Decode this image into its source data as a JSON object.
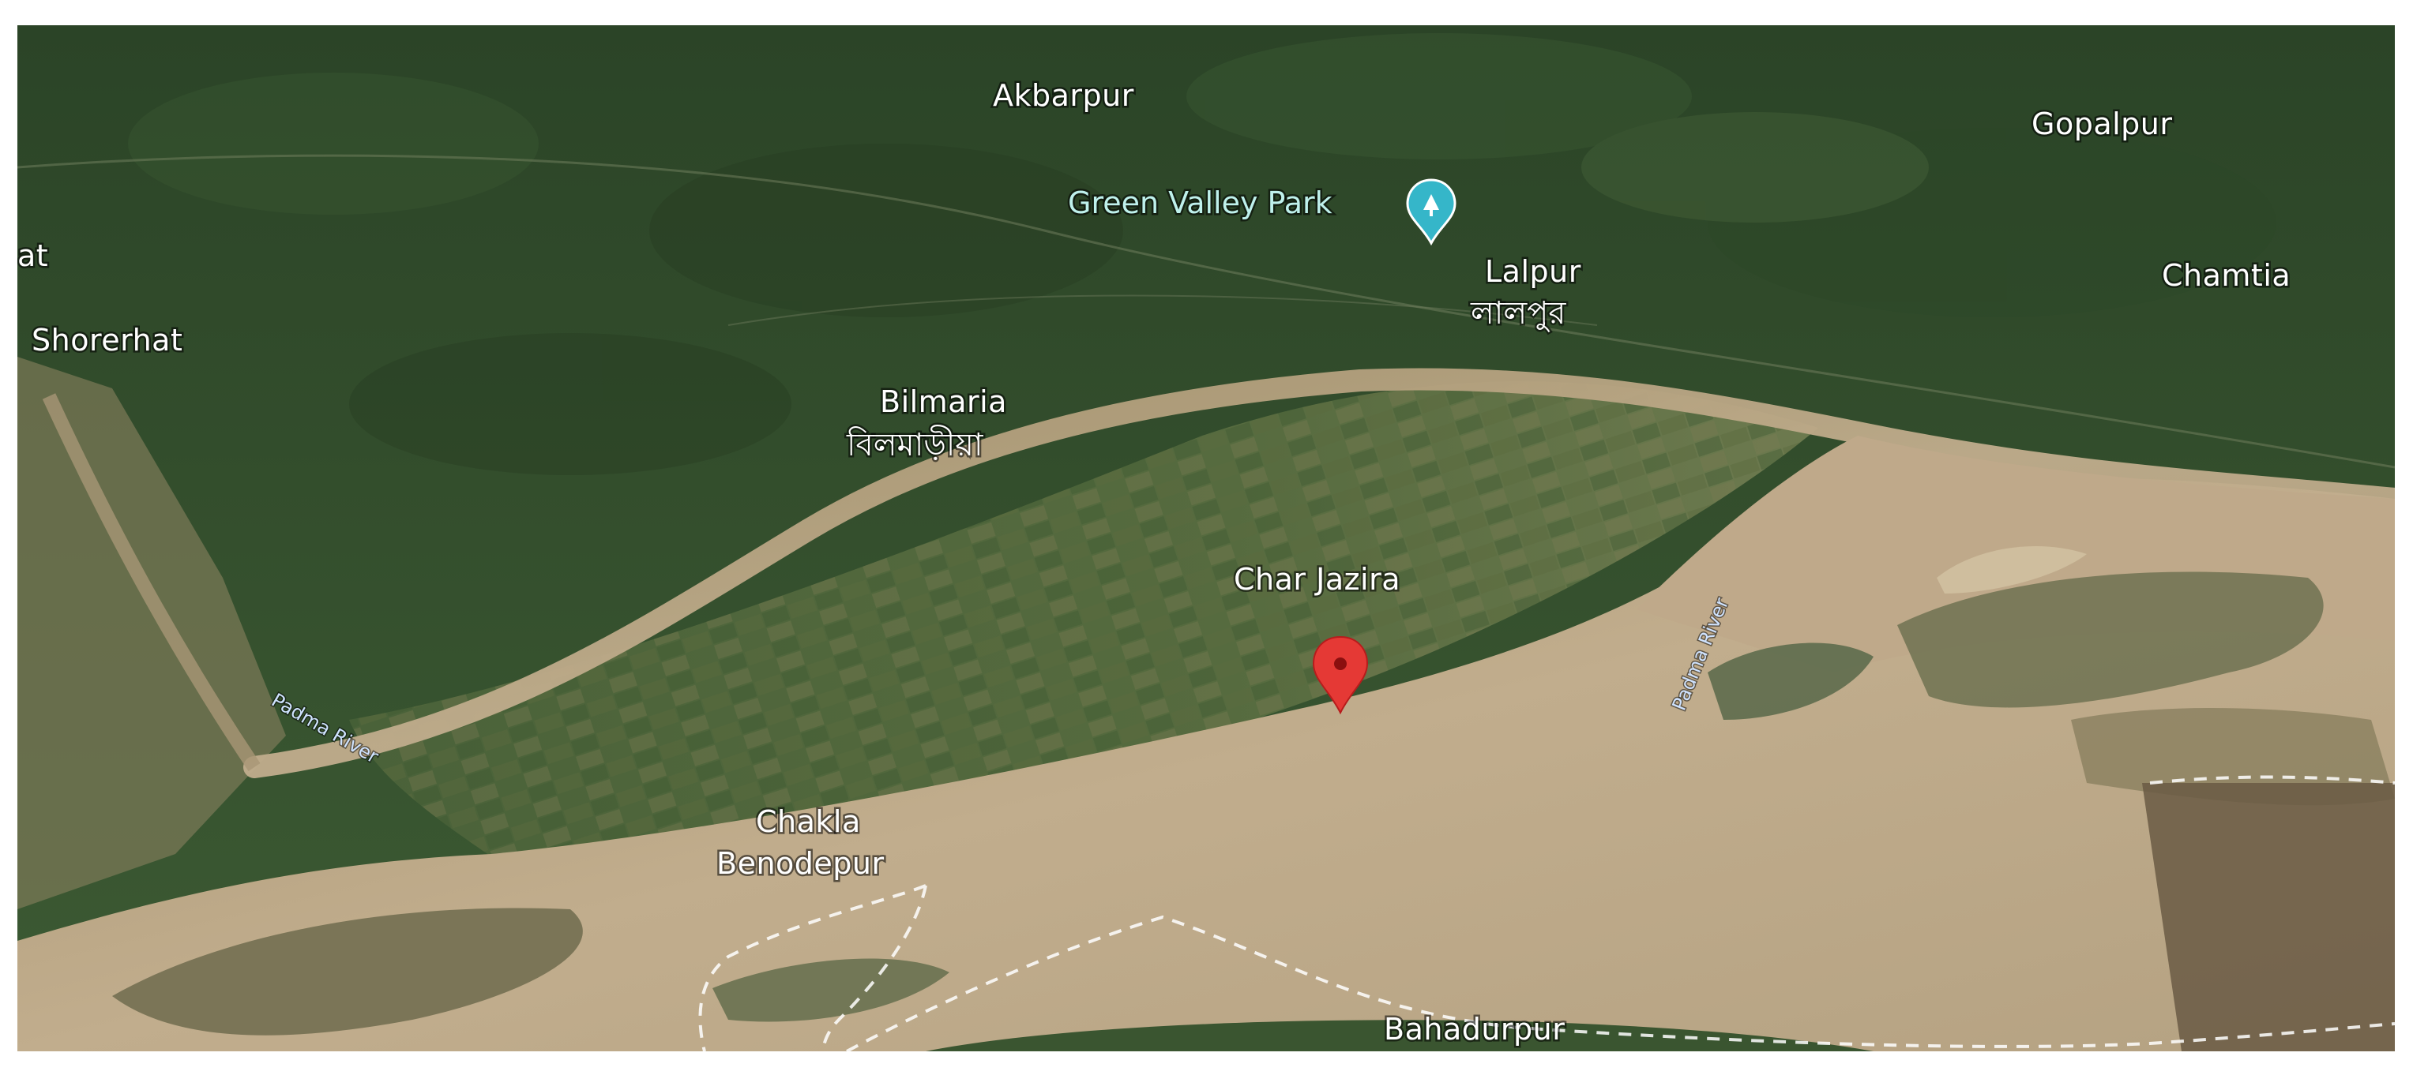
{
  "map": {
    "view": "satellite",
    "colors": {
      "vegetation": "#2f4a2b",
      "river": "#bca88a",
      "marker": "#e53935",
      "poi": "#35b6c9",
      "boundary": "#ffffff"
    },
    "places": {
      "akbarpur": "Akbarpur",
      "gopalpur": "Gopalpur",
      "green_valley_park": "Green Valley Park",
      "lalpur_en": "Lalpur",
      "lalpur_bn": "লালপুর",
      "chamtia": "Chamtia",
      "edge_cut": "at",
      "shorerhat": "Shorerhat",
      "bilmaria_en": "Bilmaria",
      "bilmaria_bn": "বিলমাড়ীয়া",
      "char_jazira": "Char Jazira",
      "chakla": "Chakla",
      "benodepur": "Benodepur",
      "bahadurpur": "Bahadurpur"
    },
    "rivers": {
      "padma_left": "Padma River",
      "padma_right": "Padma River"
    },
    "marker": {
      "icon": "map-pin-icon"
    },
    "poi_icon": "park-icon"
  }
}
